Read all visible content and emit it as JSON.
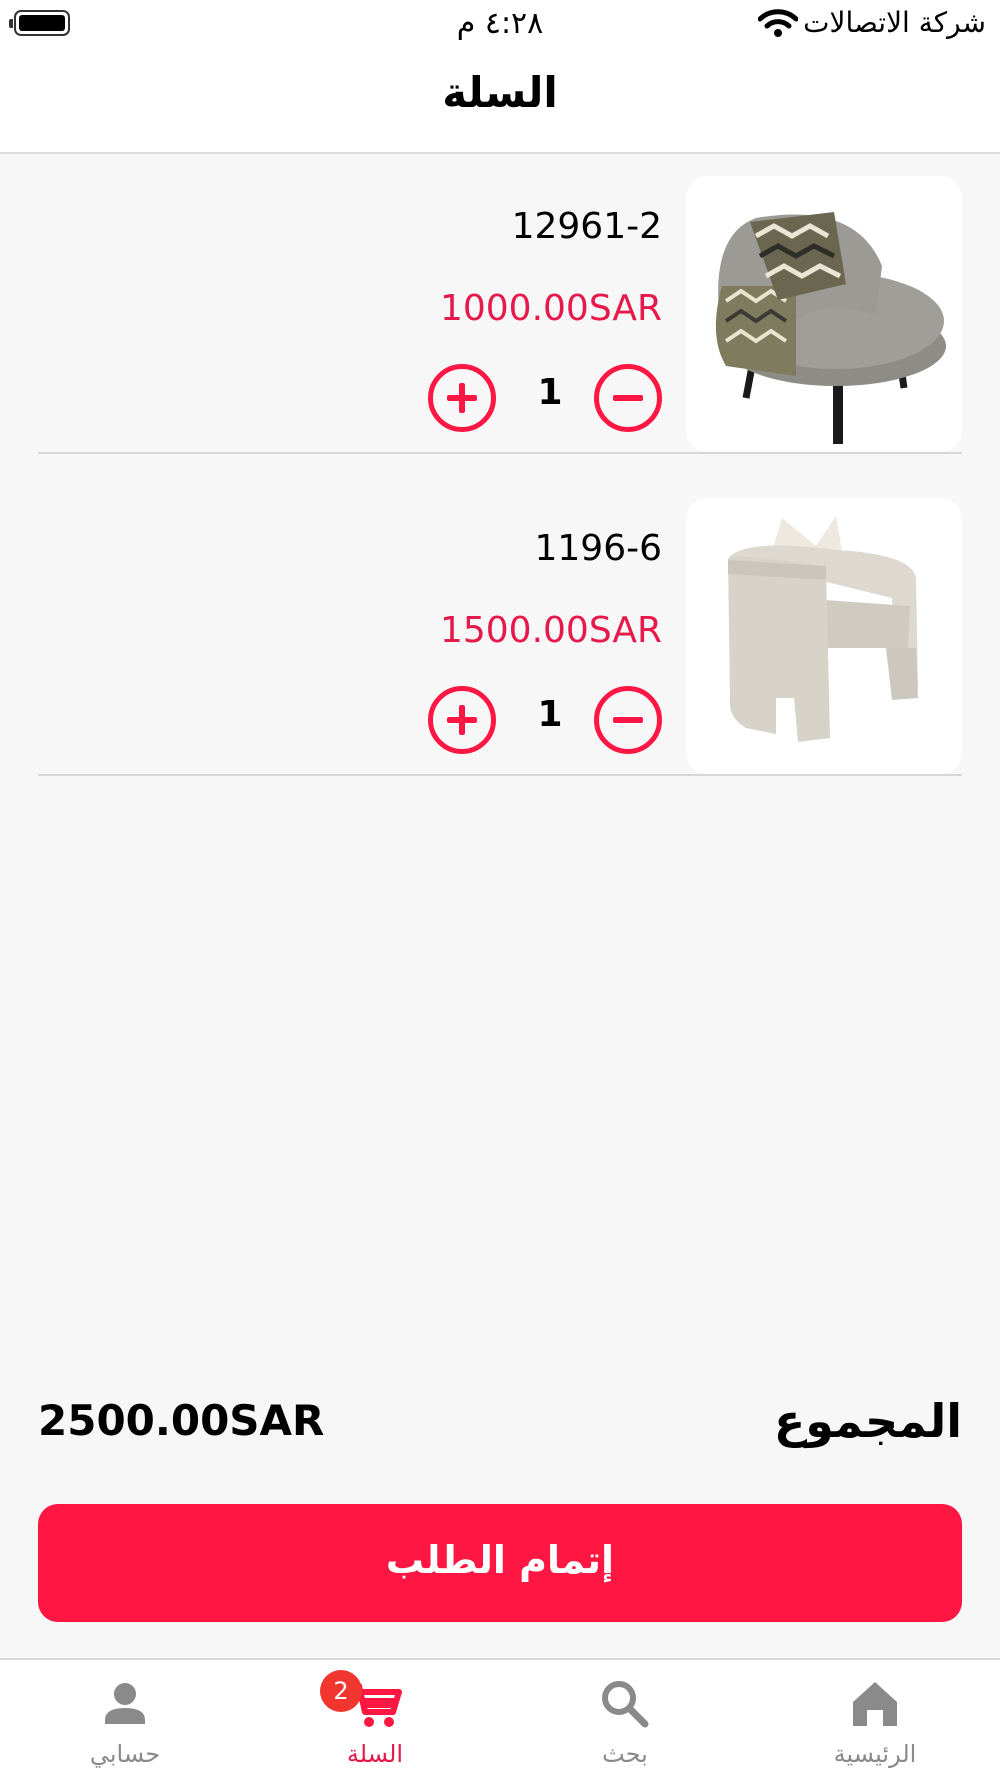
{
  "status_bar": {
    "carrier": "شركة الاتصالات",
    "time": "٤:٢٨ م"
  },
  "header": {
    "title": "السلة"
  },
  "cart": {
    "items": [
      {
        "name": "12961-2",
        "price": "1000.00SAR",
        "quantity": "1"
      },
      {
        "name": "1196-6",
        "price": "1500.00SAR",
        "quantity": "1"
      }
    ]
  },
  "summary": {
    "total_label": "المجموع",
    "total_value": "2500.00SAR"
  },
  "checkout": {
    "label": "إتمام الطلب"
  },
  "tab_bar": {
    "tabs": [
      {
        "label": "حسابي",
        "icon": "person-icon"
      },
      {
        "label": "السلة",
        "icon": "cart-icon",
        "badge": "2",
        "active": true
      },
      {
        "label": "بحث",
        "icon": "search-icon"
      },
      {
        "label": "الرئيسية",
        "icon": "home-icon"
      }
    ]
  },
  "colors": {
    "accent": "#ff1744",
    "price": "#e5194a",
    "badge": "#f1352f",
    "inactive_tab": "#8a8a8a"
  }
}
